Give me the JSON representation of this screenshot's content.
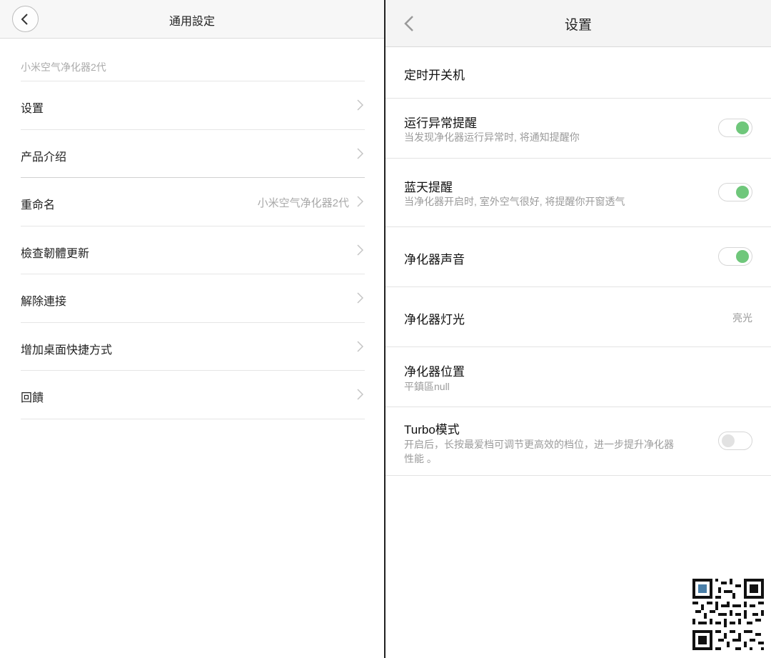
{
  "left": {
    "title": "通用設定",
    "device_label": "小米空气净化器2代",
    "items": [
      {
        "label": "设置",
        "value": ""
      },
      {
        "label": "产品介绍",
        "value": ""
      },
      {
        "label": "重命名",
        "value": "小米空气净化器2代"
      },
      {
        "label": "檢查韌體更新",
        "value": ""
      },
      {
        "label": "解除連接",
        "value": ""
      },
      {
        "label": "增加桌面快捷方式",
        "value": ""
      },
      {
        "label": "回饋",
        "value": ""
      }
    ]
  },
  "right": {
    "title": "设置",
    "items": {
      "timer": {
        "title": "定时开关机"
      },
      "abnormal": {
        "title": "运行异常提醒",
        "sub": "当发现净化器运行异常时, 将通知提醒你",
        "enabled": true
      },
      "bluesky": {
        "title": "蓝天提醒",
        "sub": "当净化器开启时, 室外空气很好, 将提醒你开窗透气",
        "enabled": true
      },
      "sound": {
        "title": "净化器声音",
        "enabled": true
      },
      "light": {
        "title": "净化器灯光",
        "value": "亮光"
      },
      "location": {
        "title": "净化器位置",
        "sub": "平鎮區null"
      },
      "turbo": {
        "title": "Turbo模式",
        "sub_line1": "开启后，长按最爱档可调节更高效的档位，进一步提升净化器",
        "sub_line2": "性能 。",
        "enabled": false
      }
    }
  },
  "colors": {
    "toggle_on": "#6fc77b",
    "toggle_off": "#e2e2e2"
  }
}
